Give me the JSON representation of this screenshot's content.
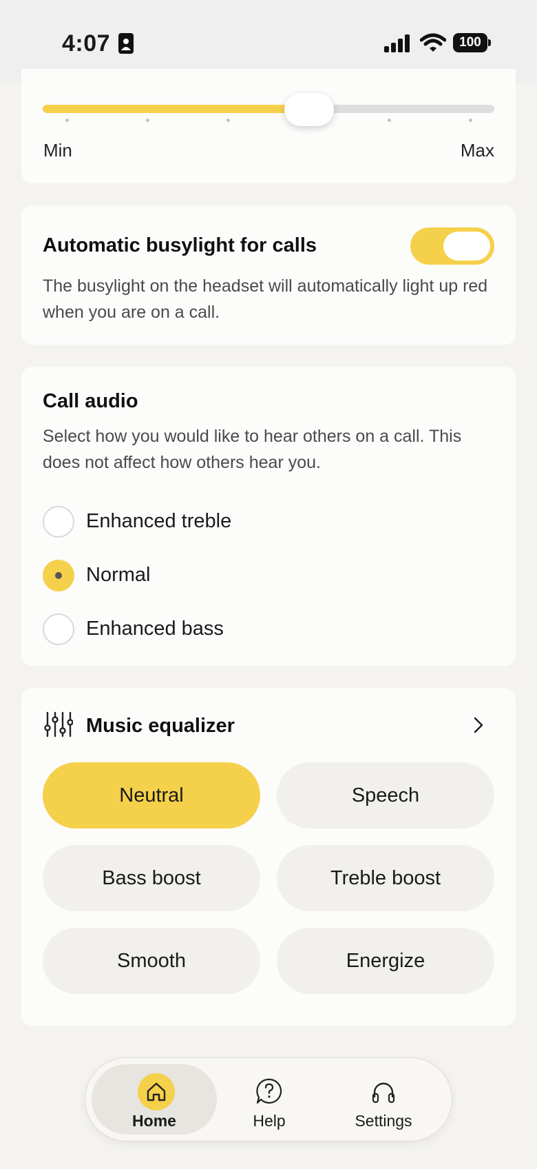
{
  "status_bar": {
    "time": "4:07",
    "battery": "100"
  },
  "sidetone_slider": {
    "value_fraction": 0.59,
    "min_label": "Min",
    "max_label": "Max",
    "step_count": 6
  },
  "busylight": {
    "title": "Automatic busylight for calls",
    "description": "The busylight on the headset will automatically light up red when you are on a call.",
    "enabled": true
  },
  "call_audio": {
    "title": "Call audio",
    "description": "Select how you would like to hear others on a call. This does not affect how others hear you.",
    "options": [
      {
        "label": "Enhanced treble",
        "selected": false
      },
      {
        "label": "Normal",
        "selected": true
      },
      {
        "label": "Enhanced bass",
        "selected": false
      }
    ]
  },
  "music_equalizer": {
    "title": "Music equalizer",
    "presets": [
      {
        "label": "Neutral",
        "active": true
      },
      {
        "label": "Speech",
        "active": false
      },
      {
        "label": "Bass boost",
        "active": false
      },
      {
        "label": "Treble boost",
        "active": false
      },
      {
        "label": "Smooth",
        "active": false
      },
      {
        "label": "Energize",
        "active": false
      }
    ]
  },
  "bottom_nav": {
    "items": [
      {
        "label": "Home",
        "icon": "home-icon",
        "active": true
      },
      {
        "label": "Help",
        "icon": "help-bubble-icon",
        "active": false
      },
      {
        "label": "Settings",
        "icon": "headset-icon",
        "active": false
      }
    ]
  },
  "colors": {
    "accent": "#f5d04a",
    "background": "#f4f3ef",
    "card": "#fcfcfb",
    "pill": "#f1f0ec"
  }
}
